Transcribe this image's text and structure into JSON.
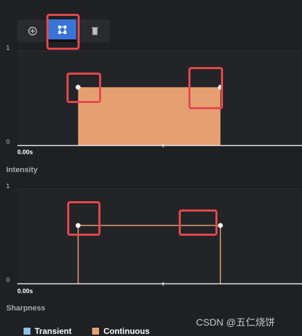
{
  "toolbar": {
    "buttons": [
      {
        "name": "add-point",
        "icon": "plus-circle-icon"
      },
      {
        "name": "select-points",
        "icon": "vector-select-icon",
        "active": true
      },
      {
        "name": "delete",
        "icon": "trash-icon"
      }
    ]
  },
  "intensity": {
    "title": "Intensity",
    "y_max_label": "1",
    "y_min_label": "0",
    "time_label": "0.00s"
  },
  "sharpness": {
    "title": "Sharpness",
    "y_max_label": "1",
    "y_min_label": "0",
    "time_label": "0.00s"
  },
  "legend": [
    {
      "label": "Transient",
      "color": "#8fc3e8"
    },
    {
      "label": "Continuous",
      "color": "#e5a072"
    }
  ],
  "watermark": "CSDN @五仁烧饼",
  "colors": {
    "accent": "#3a74d6",
    "continuous_fill": "#e5a072",
    "highlight": "#e5484d"
  },
  "chart_data": [
    {
      "type": "area",
      "title": "Intensity",
      "ylim": [
        0,
        1
      ],
      "points": [
        {
          "t": 0.25,
          "v": 0.66
        },
        {
          "t": 0.75,
          "v": 0.66
        }
      ],
      "t_range": [
        0,
        1
      ]
    },
    {
      "type": "line",
      "title": "Sharpness",
      "ylim": [
        0,
        1
      ],
      "points": [
        {
          "t": 0.25,
          "v": 0.66
        },
        {
          "t": 0.75,
          "v": 0.66
        }
      ],
      "t_range": [
        0,
        1
      ]
    }
  ]
}
